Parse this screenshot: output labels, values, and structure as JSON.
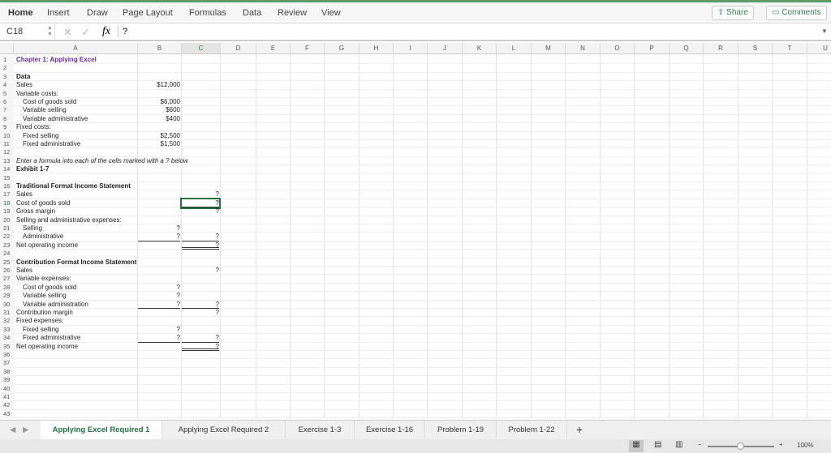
{
  "ribbon": {
    "tabs": [
      "Home",
      "Insert",
      "Draw",
      "Page Layout",
      "Formulas",
      "Data",
      "Review",
      "View"
    ],
    "share": "Share",
    "comments": "Comments"
  },
  "formula_bar": {
    "name_box": "C18",
    "fx": "fx",
    "value": "?"
  },
  "columns": [
    "A",
    "B",
    "C",
    "D",
    "E",
    "F",
    "G",
    "H",
    "I",
    "J",
    "K",
    "L",
    "M",
    "N",
    "O",
    "P",
    "Q",
    "R",
    "S",
    "T",
    "U"
  ],
  "selected_cell": "C18",
  "rows": [
    {
      "n": "1",
      "a": "Chapter 1: Applying Excel",
      "style": "bold purple"
    },
    {
      "n": "2"
    },
    {
      "n": "3",
      "a": "Data",
      "style": "bold"
    },
    {
      "n": "4",
      "a": "Sales",
      "b": "$12,000"
    },
    {
      "n": "5",
      "a": "Variable costs:"
    },
    {
      "n": "6",
      "a": "Cost of goods sold",
      "b": "$6,000",
      "indent": true
    },
    {
      "n": "7",
      "a": "Variable selling",
      "b": "$600",
      "indent": true
    },
    {
      "n": "8",
      "a": "Variable administrative",
      "b": "$400",
      "indent": true
    },
    {
      "n": "9",
      "a": "Fixed costs:"
    },
    {
      "n": "10",
      "a": "Fixed selling",
      "b": "$2,500",
      "indent": true
    },
    {
      "n": "11",
      "a": "Fixed administrative",
      "b": "$1,500",
      "indent": true
    },
    {
      "n": "12"
    },
    {
      "n": "13",
      "a": "Enter a formula into each of the cells marked with a ? below",
      "style": "it"
    },
    {
      "n": "14",
      "a": "Exhibit 1-7",
      "style": "bold"
    },
    {
      "n": "15"
    },
    {
      "n": "16",
      "a": "Traditional Format Income Statement",
      "style": "bold"
    },
    {
      "n": "17",
      "a": "Sales",
      "c": "?"
    },
    {
      "n": "18",
      "a": "Cost of goods sold",
      "c": "?",
      "cb": "bb"
    },
    {
      "n": "19",
      "a": "Gross margin",
      "c": "?"
    },
    {
      "n": "20",
      "a": "Selling and administrative expenses:"
    },
    {
      "n": "21",
      "a": "Selling",
      "b": "?",
      "indent": true
    },
    {
      "n": "22",
      "a": "Administrative",
      "b": "?",
      "c": "?",
      "indent": true,
      "bbdr": "bb",
      "cb": "bb"
    },
    {
      "n": "23",
      "a": "Net operating income",
      "c": "?",
      "cb": "dbl"
    },
    {
      "n": "24"
    },
    {
      "n": "25",
      "a": "Contribution Format Income Statement",
      "style": "bold"
    },
    {
      "n": "26",
      "a": "Sales",
      "c": "?"
    },
    {
      "n": "27",
      "a": "Variable expenses:"
    },
    {
      "n": "28",
      "a": "Cost of goods sold",
      "b": "?",
      "indent": true
    },
    {
      "n": "29",
      "a": "Variable selling",
      "b": "?",
      "indent": true
    },
    {
      "n": "30",
      "a": "Variable administration",
      "b": "?",
      "c": "?",
      "indent": true,
      "bbdr": "bb",
      "cb": "bb"
    },
    {
      "n": "31",
      "a": "Contribution margin",
      "c": "?"
    },
    {
      "n": "32",
      "a": "Fixed expenses:"
    },
    {
      "n": "33",
      "a": "Fixed selling",
      "b": "?",
      "indent": true
    },
    {
      "n": "34",
      "a": "Fixed administrative",
      "b": "?",
      "c": "?",
      "indent": true,
      "bbdr": "bb",
      "cb": "bb"
    },
    {
      "n": "35",
      "a": "Net operating income",
      "c": "?",
      "cb": "dbl"
    },
    {
      "n": "36"
    },
    {
      "n": "37"
    },
    {
      "n": "38"
    },
    {
      "n": "39"
    },
    {
      "n": "40"
    },
    {
      "n": "41"
    },
    {
      "n": "42"
    },
    {
      "n": "43"
    }
  ],
  "sheets": [
    "Applying Excel Required 1",
    "Applying Excel Required 2",
    "Exercise 1-3",
    "Exercise 1-16",
    "Problem 1-19",
    "Problem 1-22"
  ],
  "active_sheet": 0,
  "status": {
    "zoom": "100%",
    "zoom_fraction": 0.5
  }
}
